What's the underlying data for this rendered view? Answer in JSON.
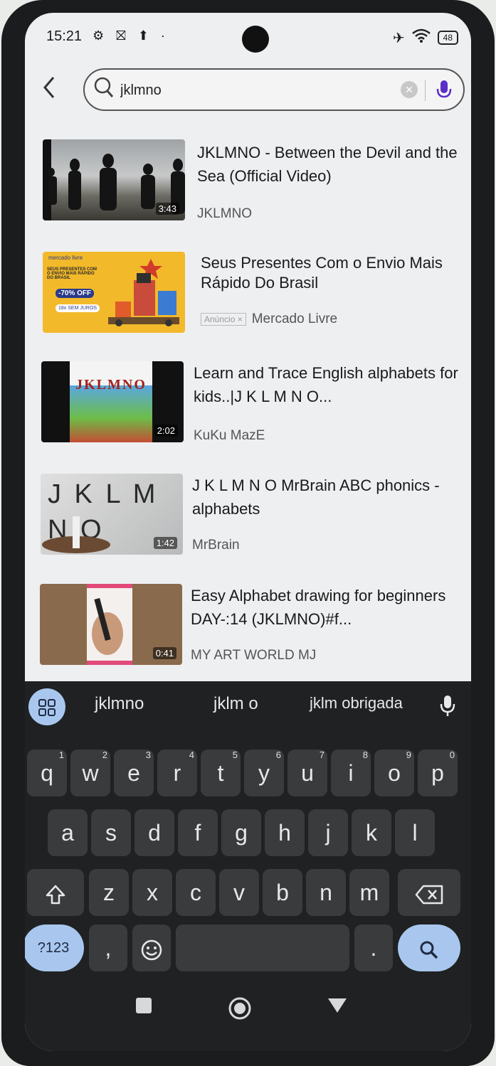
{
  "status": {
    "time": "15:21",
    "left_icons": "⚙ ⛝ ⬆ ·",
    "battery": "48"
  },
  "search": {
    "query": "jklmno",
    "placeholder": ""
  },
  "results": [
    {
      "title": "JKLMNO - Between the Devil and the Sea (Official Video)",
      "channel": "JKLMNO",
      "duration": "3:43"
    },
    {
      "title": "Seus Presentes Com o Envio Mais Rápido Do Brasil",
      "channel": "Mercado Livre",
      "ad_label": "Anúncio ×"
    },
    {
      "title": "Learn and Trace English alphabets for kids..|J K L M N O...",
      "channel": "KuKu MazE",
      "duration": "2:02",
      "thumb_text": "JKLMNO"
    },
    {
      "title": "J K L M N O MrBrain ABC phonics - alphabets",
      "channel": "MrBrain",
      "duration": "1:42",
      "thumb_text": "J K L M N O"
    },
    {
      "title": "Easy Alphabet drawing for beginners DAY-:14 (JKLMNO)#f...",
      "channel": "MY ART WORLD MJ",
      "duration": "0:41"
    }
  ],
  "ad_thumb": {
    "brand": "mercado livre",
    "line": "SEUS PRESENTES COM O ENVIO MAIS RÁPIDO DO BRASIL",
    "discount": "-70% OFF",
    "installments": "18x SEM JUROS"
  },
  "keyboard": {
    "suggestions": [
      "jklmno",
      "jklm o",
      "jklm obrigada"
    ],
    "row1": [
      [
        "q",
        "1"
      ],
      [
        "w",
        "2"
      ],
      [
        "e",
        "3"
      ],
      [
        "r",
        "4"
      ],
      [
        "t",
        "5"
      ],
      [
        "y",
        "6"
      ],
      [
        "u",
        "7"
      ],
      [
        "i",
        "8"
      ],
      [
        "o",
        "9"
      ],
      [
        "p",
        "0"
      ]
    ],
    "row2": [
      "a",
      "s",
      "d",
      "f",
      "g",
      "h",
      "j",
      "k",
      "l"
    ],
    "row3": [
      "z",
      "x",
      "c",
      "v",
      "b",
      "n",
      "m"
    ],
    "symbols_label": "?123",
    "comma": ",",
    "period": "."
  },
  "colors": {
    "accent_key": "#a9c7ee",
    "mic": "#5b2dc9",
    "keyboard_bg": "#1f2123"
  }
}
